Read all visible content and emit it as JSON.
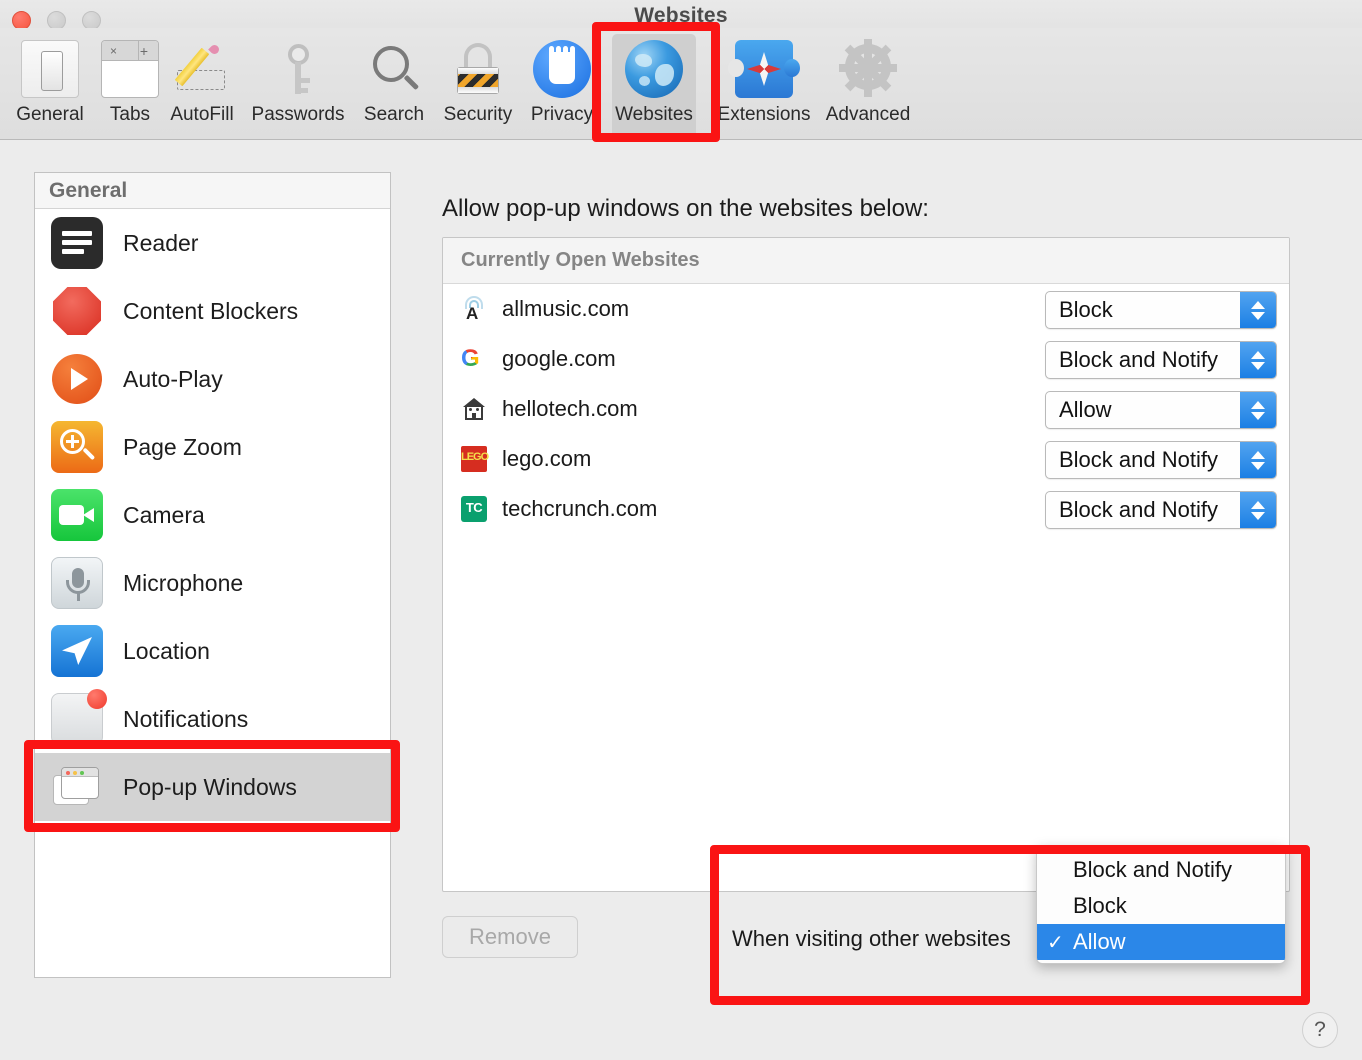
{
  "window": {
    "title": "Websites",
    "traffic_lights": [
      "close",
      "minimize",
      "zoom"
    ]
  },
  "toolbar": {
    "items": [
      {
        "label": "General",
        "icon": "general-icon",
        "selected": false
      },
      {
        "label": "Tabs",
        "icon": "tabs-icon",
        "selected": false
      },
      {
        "label": "AutoFill",
        "icon": "autofill-icon",
        "selected": false
      },
      {
        "label": "Passwords",
        "icon": "passwords-icon",
        "selected": false
      },
      {
        "label": "Search",
        "icon": "search-icon",
        "selected": false
      },
      {
        "label": "Security",
        "icon": "security-icon",
        "selected": false
      },
      {
        "label": "Privacy",
        "icon": "privacy-icon",
        "selected": false
      },
      {
        "label": "Websites",
        "icon": "websites-icon",
        "selected": true
      },
      {
        "label": "Extensions",
        "icon": "extensions-icon",
        "selected": false
      },
      {
        "label": "Advanced",
        "icon": "advanced-icon",
        "selected": false
      }
    ]
  },
  "sidebar": {
    "header": "General",
    "items": [
      {
        "label": "Reader",
        "icon": "reader-icon",
        "selected": false
      },
      {
        "label": "Content Blockers",
        "icon": "content-blockers-icon",
        "selected": false
      },
      {
        "label": "Auto-Play",
        "icon": "auto-play-icon",
        "selected": false
      },
      {
        "label": "Page Zoom",
        "icon": "page-zoom-icon",
        "selected": false
      },
      {
        "label": "Camera",
        "icon": "camera-icon",
        "selected": false
      },
      {
        "label": "Microphone",
        "icon": "microphone-icon",
        "selected": false
      },
      {
        "label": "Location",
        "icon": "location-icon",
        "selected": false
      },
      {
        "label": "Notifications",
        "icon": "notifications-icon",
        "selected": false
      },
      {
        "label": "Pop-up Windows",
        "icon": "popup-windows-icon",
        "selected": true
      }
    ]
  },
  "content": {
    "heading": "Allow pop-up windows on the websites below:",
    "list_header": "Currently Open Websites",
    "rows": [
      {
        "site": "allmusic.com",
        "icon": "allmusic-favicon",
        "setting": "Block"
      },
      {
        "site": "google.com",
        "icon": "google-favicon",
        "setting": "Block and Notify"
      },
      {
        "site": "hellotech.com",
        "icon": "hellotech-favicon",
        "setting": "Allow"
      },
      {
        "site": "lego.com",
        "icon": "lego-favicon",
        "setting": "Block and Notify"
      },
      {
        "site": "techcrunch.com",
        "icon": "techcrunch-favicon",
        "setting": "Block and Notify"
      }
    ],
    "remove_label": "Remove",
    "visiting_label": "When visiting other websites",
    "help_label": "?"
  },
  "popup_menu": {
    "options": [
      {
        "label": "Block and Notify",
        "checked": false
      },
      {
        "label": "Block",
        "checked": false
      },
      {
        "label": "Allow",
        "checked": true
      }
    ],
    "check_glyph": "✓"
  },
  "colors": {
    "annotation_red": "#fa1414",
    "stepper_blue": "#2b87e8",
    "menu_highlight": "#2b87e8",
    "selected_row": "#d3d3d3"
  }
}
